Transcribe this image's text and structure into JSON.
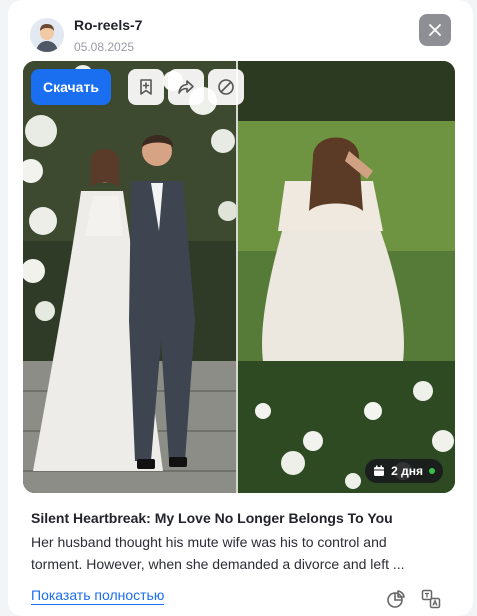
{
  "post": {
    "author": "Ro-reels-7",
    "date": "05.08.2025",
    "title": "Silent Heartbreak: My Love No Longer Belongs To You",
    "description": "Her husband thought his mute wife was his to control and torment. However, when she demanded a divorce and left ...",
    "show_more_label": "Показать полностью"
  },
  "media": {
    "download_label": "Скачать",
    "age_label": "2 дня",
    "age_dot_color": "#36c24a"
  },
  "icons": {
    "close": "close-icon",
    "bookmark": "bookmark-icon",
    "share": "share-icon",
    "block": "block-icon",
    "calendar": "calendar-icon",
    "stats": "pie-chart-icon",
    "translate": "translate-icon"
  },
  "colors": {
    "accent": "#1a6ef0",
    "close_button": "#8e8f95"
  }
}
